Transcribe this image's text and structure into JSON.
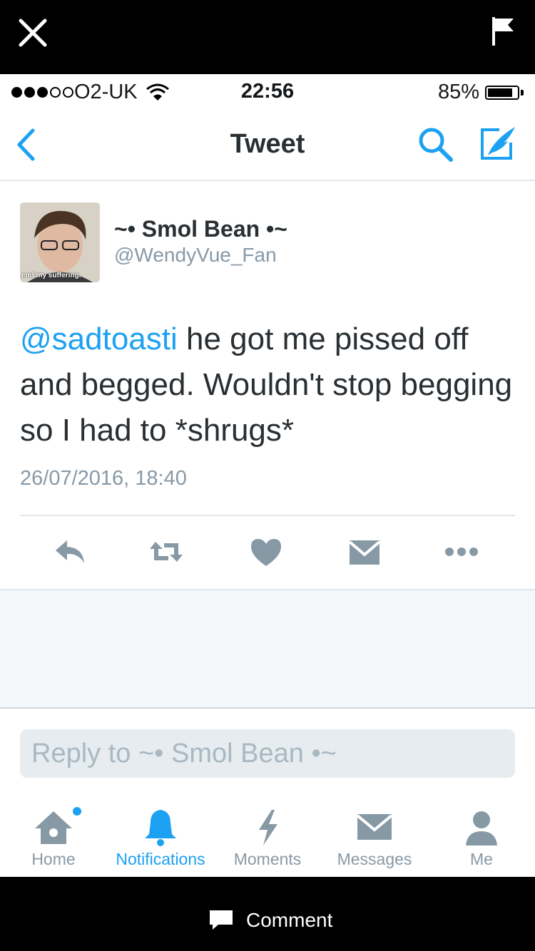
{
  "status_bar": {
    "carrier": "O2-UK",
    "time": "22:56",
    "battery_percent_label": "85%",
    "battery_level": 0.85,
    "signal_bars_filled": 3,
    "signal_bars_total": 5
  },
  "nav": {
    "title": "Tweet"
  },
  "tweet": {
    "display_name": "~• Smol Bean •~",
    "handle": "@WendyVue_Fan",
    "avatar_caption": "end my suffering.",
    "mention": "@sadtoasti",
    "text": " he got me pissed off and begged. Wouldn't stop begging so I had to *shrugs*",
    "timestamp": "26/07/2016, 18:40"
  },
  "actions": [
    "reply-icon",
    "retweet-icon",
    "like-icon",
    "direct-message-icon",
    "more-icon"
  ],
  "reply": {
    "placeholder": "Reply to ~• Smol Bean •~"
  },
  "tabs": [
    {
      "label": "Home",
      "icon": "home-icon",
      "active": false
    },
    {
      "label": "Notifications",
      "icon": "bell-icon",
      "active": true
    },
    {
      "label": "Moments",
      "icon": "lightning-icon",
      "active": false
    },
    {
      "label": "Messages",
      "icon": "envelope-icon",
      "active": false
    },
    {
      "label": "Me",
      "icon": "person-icon",
      "active": false
    }
  ],
  "bottom": {
    "comment_label": "Comment"
  },
  "colors": {
    "accent": "#1da1f2",
    "muted": "#8899a6",
    "text": "#292f33"
  }
}
